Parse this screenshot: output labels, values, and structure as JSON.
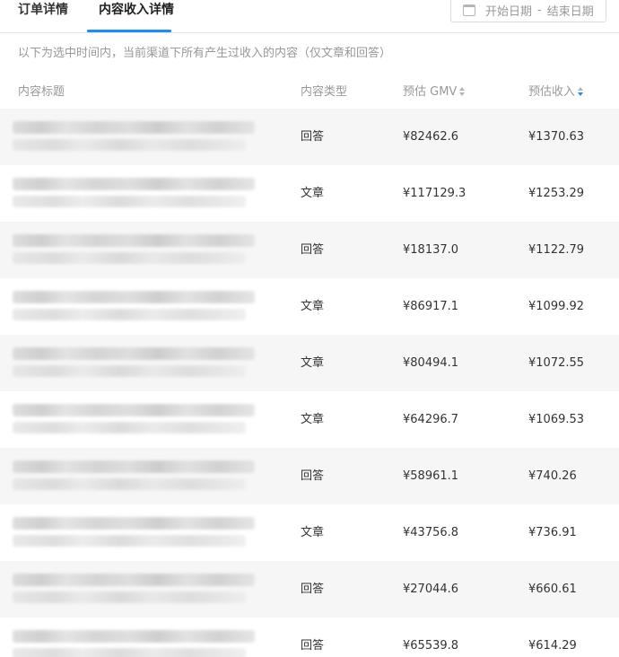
{
  "tabs": [
    {
      "label": "订单详情",
      "active": false
    },
    {
      "label": "内容收入详情",
      "active": true
    }
  ],
  "date_range": {
    "start_placeholder": "开始日期",
    "separator": "-",
    "end_placeholder": "结束日期"
  },
  "description": "以下为选中时间内，当前渠道下所有产生过收入的内容（仅文章和回答）",
  "colors": {
    "accent": "#1a8cff"
  },
  "table": {
    "columns": [
      "内容标题",
      "内容类型",
      "预估 GMV",
      "预估收入"
    ],
    "rows": [
      {
        "type": "回答",
        "gmv": "¥82462.6",
        "income": "¥1370.63"
      },
      {
        "type": "文章",
        "gmv": "¥117129.3",
        "income": "¥1253.29"
      },
      {
        "type": "回答",
        "gmv": "¥18137.0",
        "income": "¥1122.79"
      },
      {
        "type": "文章",
        "gmv": "¥86917.1",
        "income": "¥1099.92"
      },
      {
        "type": "文章",
        "gmv": "¥80494.1",
        "income": "¥1072.55"
      },
      {
        "type": "文章",
        "gmv": "¥64296.7",
        "income": "¥1069.53"
      },
      {
        "type": "回答",
        "gmv": "¥58961.1",
        "income": "¥740.26"
      },
      {
        "type": "文章",
        "gmv": "¥43756.8",
        "income": "¥736.91"
      },
      {
        "type": "回答",
        "gmv": "¥27044.6",
        "income": "¥660.61"
      },
      {
        "type": "回答",
        "gmv": "¥65539.8",
        "income": "¥614.29"
      }
    ]
  }
}
